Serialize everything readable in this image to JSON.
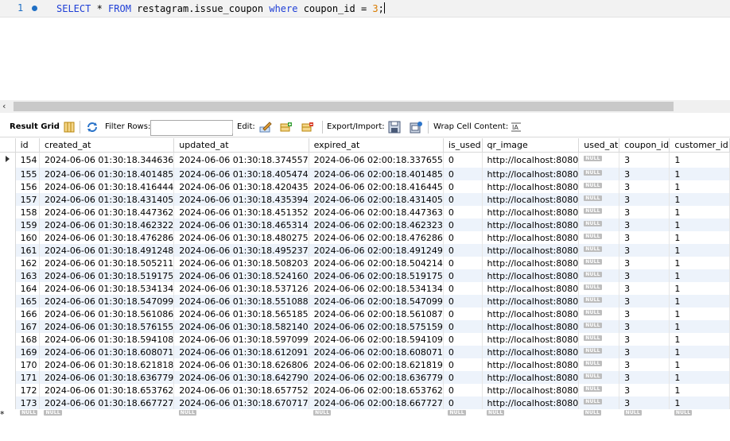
{
  "editor": {
    "line_number": "1",
    "code": {
      "kw1": "SELECT",
      "star": " * ",
      "kw2": "FROM",
      "table": " restagram.issue_coupon ",
      "kw3": "where",
      "cond": " coupon_id = ",
      "value": "3",
      "end": ";"
    }
  },
  "toolbar": {
    "result_grid": "Result Grid",
    "filter_rows": "Filter Rows:",
    "filter_value": "",
    "edit": "Edit:",
    "export_import": "Export/Import:",
    "wrap_cell": "Wrap Cell Content:"
  },
  "grid": {
    "columns": [
      "id",
      "created_at",
      "updated_at",
      "expired_at",
      "is_used",
      "qr_image",
      "used_at",
      "coupon_id",
      "customer_id"
    ],
    "null_label": "NULL",
    "rows": [
      [
        "154",
        "2024-06-06 01:30:18.344636",
        "2024-06-06 01:30:18.374557",
        "2024-06-06 02:00:18.337655",
        "0",
        "http://localhost:8080",
        "NULL",
        "3",
        "1"
      ],
      [
        "155",
        "2024-06-06 01:30:18.401485",
        "2024-06-06 01:30:18.405474",
        "2024-06-06 02:00:18.401485",
        "0",
        "http://localhost:8080",
        "NULL",
        "3",
        "1"
      ],
      [
        "156",
        "2024-06-06 01:30:18.416444",
        "2024-06-06 01:30:18.420435",
        "2024-06-06 02:00:18.416445",
        "0",
        "http://localhost:8080",
        "NULL",
        "3",
        "1"
      ],
      [
        "157",
        "2024-06-06 01:30:18.431405",
        "2024-06-06 01:30:18.435394",
        "2024-06-06 02:00:18.431405",
        "0",
        "http://localhost:8080",
        "NULL",
        "3",
        "1"
      ],
      [
        "158",
        "2024-06-06 01:30:18.447362",
        "2024-06-06 01:30:18.451352",
        "2024-06-06 02:00:18.447363",
        "0",
        "http://localhost:8080",
        "NULL",
        "3",
        "1"
      ],
      [
        "159",
        "2024-06-06 01:30:18.462322",
        "2024-06-06 01:30:18.465314",
        "2024-06-06 02:00:18.462323",
        "0",
        "http://localhost:8080",
        "NULL",
        "3",
        "1"
      ],
      [
        "160",
        "2024-06-06 01:30:18.476286",
        "2024-06-06 01:30:18.480275",
        "2024-06-06 02:00:18.476286",
        "0",
        "http://localhost:8080",
        "NULL",
        "3",
        "1"
      ],
      [
        "161",
        "2024-06-06 01:30:18.491248",
        "2024-06-06 01:30:18.495237",
        "2024-06-06 02:00:18.491249",
        "0",
        "http://localhost:8080",
        "NULL",
        "3",
        "1"
      ],
      [
        "162",
        "2024-06-06 01:30:18.505211",
        "2024-06-06 01:30:18.508203",
        "2024-06-06 02:00:18.504214",
        "0",
        "http://localhost:8080",
        "NULL",
        "3",
        "1"
      ],
      [
        "163",
        "2024-06-06 01:30:18.519175",
        "2024-06-06 01:30:18.524160",
        "2024-06-06 02:00:18.519175",
        "0",
        "http://localhost:8080",
        "NULL",
        "3",
        "1"
      ],
      [
        "164",
        "2024-06-06 01:30:18.534134",
        "2024-06-06 01:30:18.537126",
        "2024-06-06 02:00:18.534134",
        "0",
        "http://localhost:8080",
        "NULL",
        "3",
        "1"
      ],
      [
        "165",
        "2024-06-06 01:30:18.547099",
        "2024-06-06 01:30:18.551088",
        "2024-06-06 02:00:18.547099",
        "0",
        "http://localhost:8080",
        "NULL",
        "3",
        "1"
      ],
      [
        "166",
        "2024-06-06 01:30:18.561086",
        "2024-06-06 01:30:18.565185",
        "2024-06-06 02:00:18.561087",
        "0",
        "http://localhost:8080",
        "NULL",
        "3",
        "1"
      ],
      [
        "167",
        "2024-06-06 01:30:18.576155",
        "2024-06-06 01:30:18.582140",
        "2024-06-06 02:00:18.575159",
        "0",
        "http://localhost:8080",
        "NULL",
        "3",
        "1"
      ],
      [
        "168",
        "2024-06-06 01:30:18.594108",
        "2024-06-06 01:30:18.597099",
        "2024-06-06 02:00:18.594109",
        "0",
        "http://localhost:8080",
        "NULL",
        "3",
        "1"
      ],
      [
        "169",
        "2024-06-06 01:30:18.608071",
        "2024-06-06 01:30:18.612091",
        "2024-06-06 02:00:18.608071",
        "0",
        "http://localhost:8080",
        "NULL",
        "3",
        "1"
      ],
      [
        "170",
        "2024-06-06 01:30:18.621818",
        "2024-06-06 01:30:18.626806",
        "2024-06-06 02:00:18.621819",
        "0",
        "http://localhost:8080",
        "NULL",
        "3",
        "1"
      ],
      [
        "171",
        "2024-06-06 01:30:18.636779",
        "2024-06-06 01:30:18.642790",
        "2024-06-06 02:00:18.636779",
        "0",
        "http://localhost:8080",
        "NULL",
        "3",
        "1"
      ],
      [
        "172",
        "2024-06-06 01:30:18.653762",
        "2024-06-06 01:30:18.657752",
        "2024-06-06 02:00:18.653762",
        "0",
        "http://localhost:8080",
        "NULL",
        "3",
        "1"
      ],
      [
        "173",
        "2024-06-06 01:30:18.667727",
        "2024-06-06 01:30:18.670717",
        "2024-06-06 02:00:18.667727",
        "0",
        "http://localhost:8080",
        "NULL",
        "3",
        "1"
      ]
    ]
  },
  "colors": {
    "keyword": "#1f3fd6",
    "number": "#d97c00",
    "line_number": "#1f6fc4",
    "row_alt": "#edf3fb"
  }
}
